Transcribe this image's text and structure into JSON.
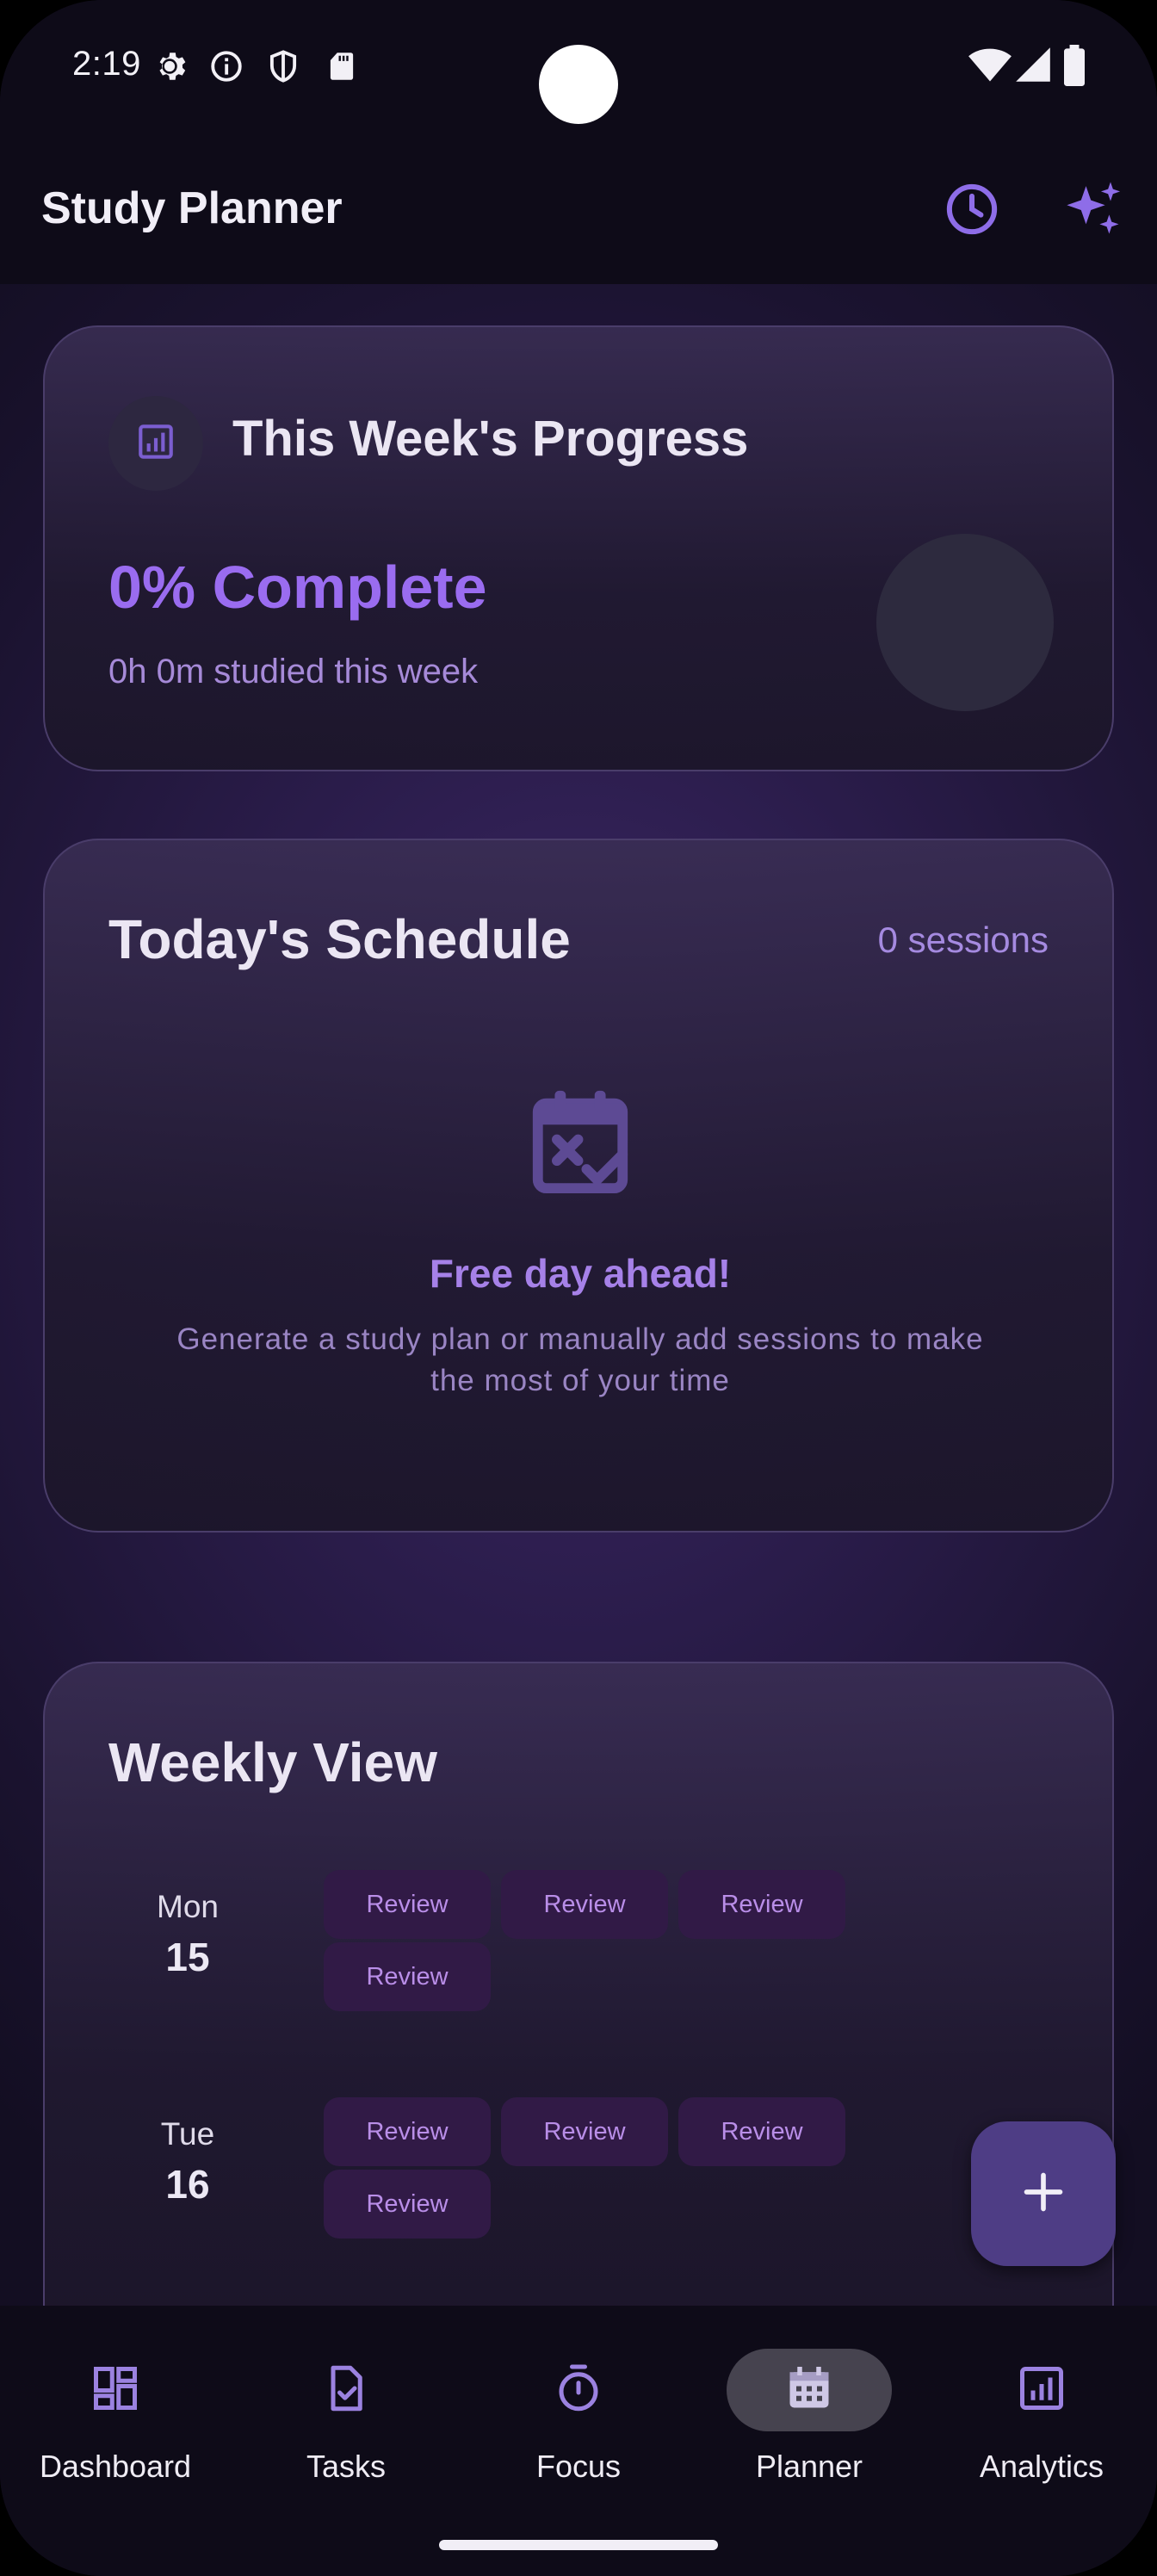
{
  "status_bar": {
    "time": "2:19",
    "left_icons": [
      "gear-icon",
      "info-icon",
      "shield-icon",
      "sd-card-icon"
    ],
    "right_icons": [
      "wifi-icon",
      "signal-icon",
      "battery-icon"
    ]
  },
  "app_bar": {
    "title": "Study Planner",
    "actions": [
      "clock-icon",
      "sparkles-icon"
    ]
  },
  "progress_card": {
    "title": "This Week's Progress",
    "percent_text": "0% Complete",
    "studied_text": "0h 0m studied this week",
    "progress_fraction": 0
  },
  "schedule_card": {
    "title": "Today's Schedule",
    "session_count": "0 sessions",
    "empty_title": "Free day ahead!",
    "empty_description": "Generate a study plan or manually add sessions to make the most of your time"
  },
  "weekly_card": {
    "title": "Weekly View",
    "days": [
      {
        "name": "Mon",
        "date": "15",
        "sessions": [
          "Review",
          "Review",
          "Review",
          "Review"
        ]
      },
      {
        "name": "Tue",
        "date": "16",
        "sessions": [
          "Review",
          "Review",
          "Review",
          "Review"
        ]
      }
    ]
  },
  "fab": {
    "icon": "plus-icon"
  },
  "bottom_nav": {
    "items": [
      {
        "label": "Dashboard",
        "icon": "dashboard-icon",
        "active": false
      },
      {
        "label": "Tasks",
        "icon": "task-check-icon",
        "active": false
      },
      {
        "label": "Focus",
        "icon": "timer-icon",
        "active": false
      },
      {
        "label": "Planner",
        "icon": "calendar-icon",
        "active": true
      },
      {
        "label": "Analytics",
        "icon": "analytics-icon",
        "active": false
      }
    ]
  },
  "colors": {
    "accent": "#9a6cf0",
    "chip_bg": "#311a46",
    "chip_text": "#b98ee8",
    "fab_bg": "#4e3d85",
    "bar_bg": "#0e0b18"
  }
}
